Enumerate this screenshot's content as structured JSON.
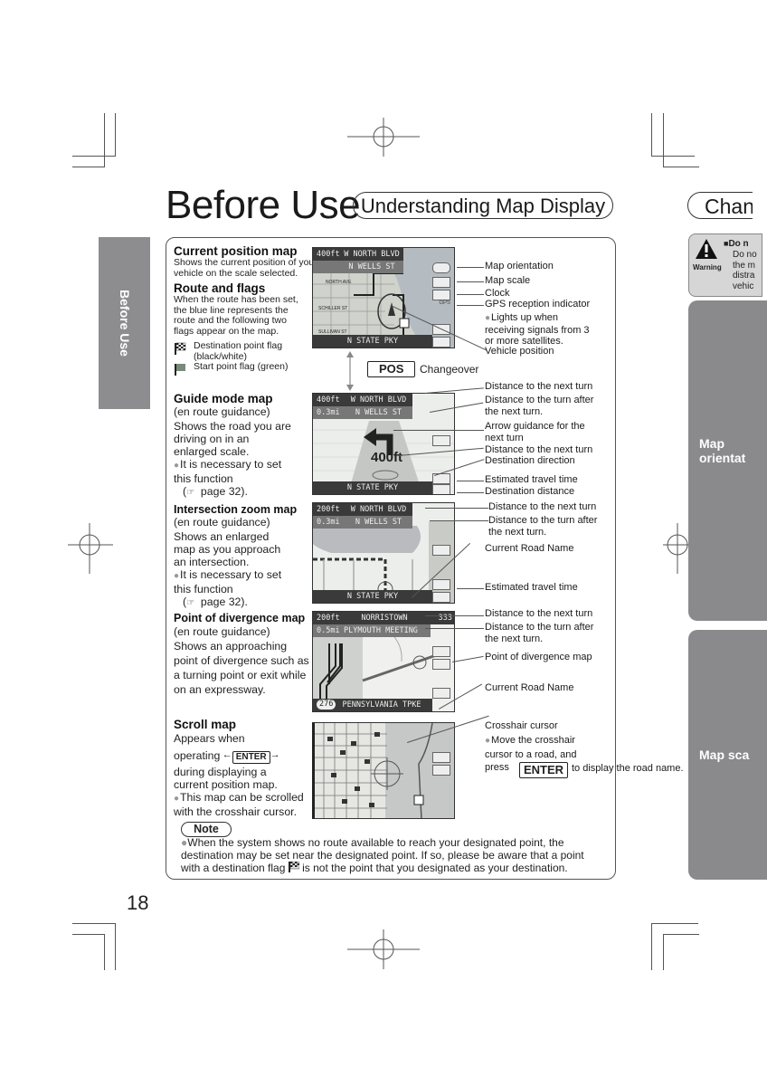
{
  "page": {
    "title": "Before Use",
    "subtitle": "Understanding Map Display",
    "next_page_title_partial": "Chang",
    "page_number": "18",
    "side_tab": "Before Use"
  },
  "sections": {
    "current_position": {
      "heading": "Current position map",
      "text": "Shows the current position of your vehicle on the scale selected."
    },
    "route_flags": {
      "heading": "Route and flags",
      "text": "When the route has been set, the blue line represents the route and the following two flags appear on the map.",
      "flags": [
        {
          "icon": "destination-flag-icon",
          "label": "Destination point flag (black/white)"
        },
        {
          "icon": "start-flag-icon",
          "label": "Start point flag (green)"
        }
      ]
    },
    "guide_mode": {
      "heading": "Guide mode map",
      "sub": "(en route guidance)",
      "text": "Shows the road you are driving on in an enlarged scale.",
      "bullet": "It is necessary to set this function",
      "ref": "page 32)."
    },
    "intersection_zoom": {
      "heading": "Intersection zoom map",
      "sub": "(en route guidance)",
      "text": "Shows an enlarged map as you approach an intersection.",
      "bullet": "It is necessary to set this function",
      "ref": "page 32)."
    },
    "divergence": {
      "heading": "Point of divergence map",
      "sub": "(en route guidance)",
      "text": "Shows an approaching point of divergence such as a turning point or exit while on an expressway."
    },
    "scroll": {
      "heading": "Scroll map",
      "text1": "Appears when",
      "text2": "operating",
      "key": "ENTER",
      "text3": "during displaying a current position map.",
      "bullet": "This map can be scrolled with the crosshair cursor."
    }
  },
  "changeover": {
    "key": "POS",
    "label": "Changeover"
  },
  "screens": {
    "current": {
      "top_left": "400ft",
      "top_center": "W NORTH BLVD",
      "second": "N WELLS ST",
      "bottom": "N STATE PKY",
      "labels": [
        "NORTH AVE",
        "SCHILLER ST",
        "SULLIVAN ST"
      ]
    },
    "guide": {
      "top_left": "400ft",
      "top_center": "W NORTH BLVD",
      "second_left": "0.3mi",
      "second": "N WELLS ST",
      "big_distance": "400ft",
      "bottom": "N STATE PKY"
    },
    "intersection": {
      "top_left": "200ft",
      "top_center": "W NORTH BLVD",
      "second_left": "0.3mi",
      "second": "N WELLS ST",
      "bottom": "N STATE PKY"
    },
    "divergence": {
      "top_left": "200ft",
      "top_center": "NORRISTOWN",
      "top_right": "333",
      "second_left": "0.5mi",
      "second": "PLYMOUTH MEETING",
      "route_shield": "276",
      "bottom": "PENNSYLVANIA TPKE"
    }
  },
  "annotations": {
    "current": [
      "Map orientation",
      "Map scale",
      "Clock",
      "GPS reception indicator",
      "Lights up when receiving signals from 3 or more satellites.",
      "Vehicle position"
    ],
    "guide": [
      "Distance to the next turn",
      "Distance to the turn after the next turn.",
      "Arrow guidance for the next turn",
      "Distance to the next turn",
      "Destination direction",
      "Estimated travel time",
      "Destination distance"
    ],
    "intersection": [
      "Distance to the next turn",
      "Distance to the turn after the next turn.",
      "Current Road Name",
      "Estimated travel time"
    ],
    "divergence": [
      "Distance to the next turn",
      "Distance to the turn after the next turn.",
      "Point of divergence map",
      "Current Road Name"
    ],
    "scroll": {
      "title": "Crosshair cursor",
      "bullet_pre": "Move the crosshair cursor to a road, and press",
      "key": "ENTER",
      "bullet_post": "to display the road name."
    }
  },
  "note": {
    "label": "Note",
    "text_pre": "When the system shows no route available to reach your designated point, the destination may be set near the designated point. If so, please be aware that a point with a destination flag",
    "text_post": "is not the point that you designated as your destination."
  },
  "right_margin": {
    "warning_label": "Warning",
    "warning_heading": "Do n",
    "warning_lines": [
      "Do no",
      "the m",
      "distra",
      "vehic"
    ],
    "tab1": [
      "Map",
      "orientat"
    ],
    "tab2": "Map sca"
  }
}
